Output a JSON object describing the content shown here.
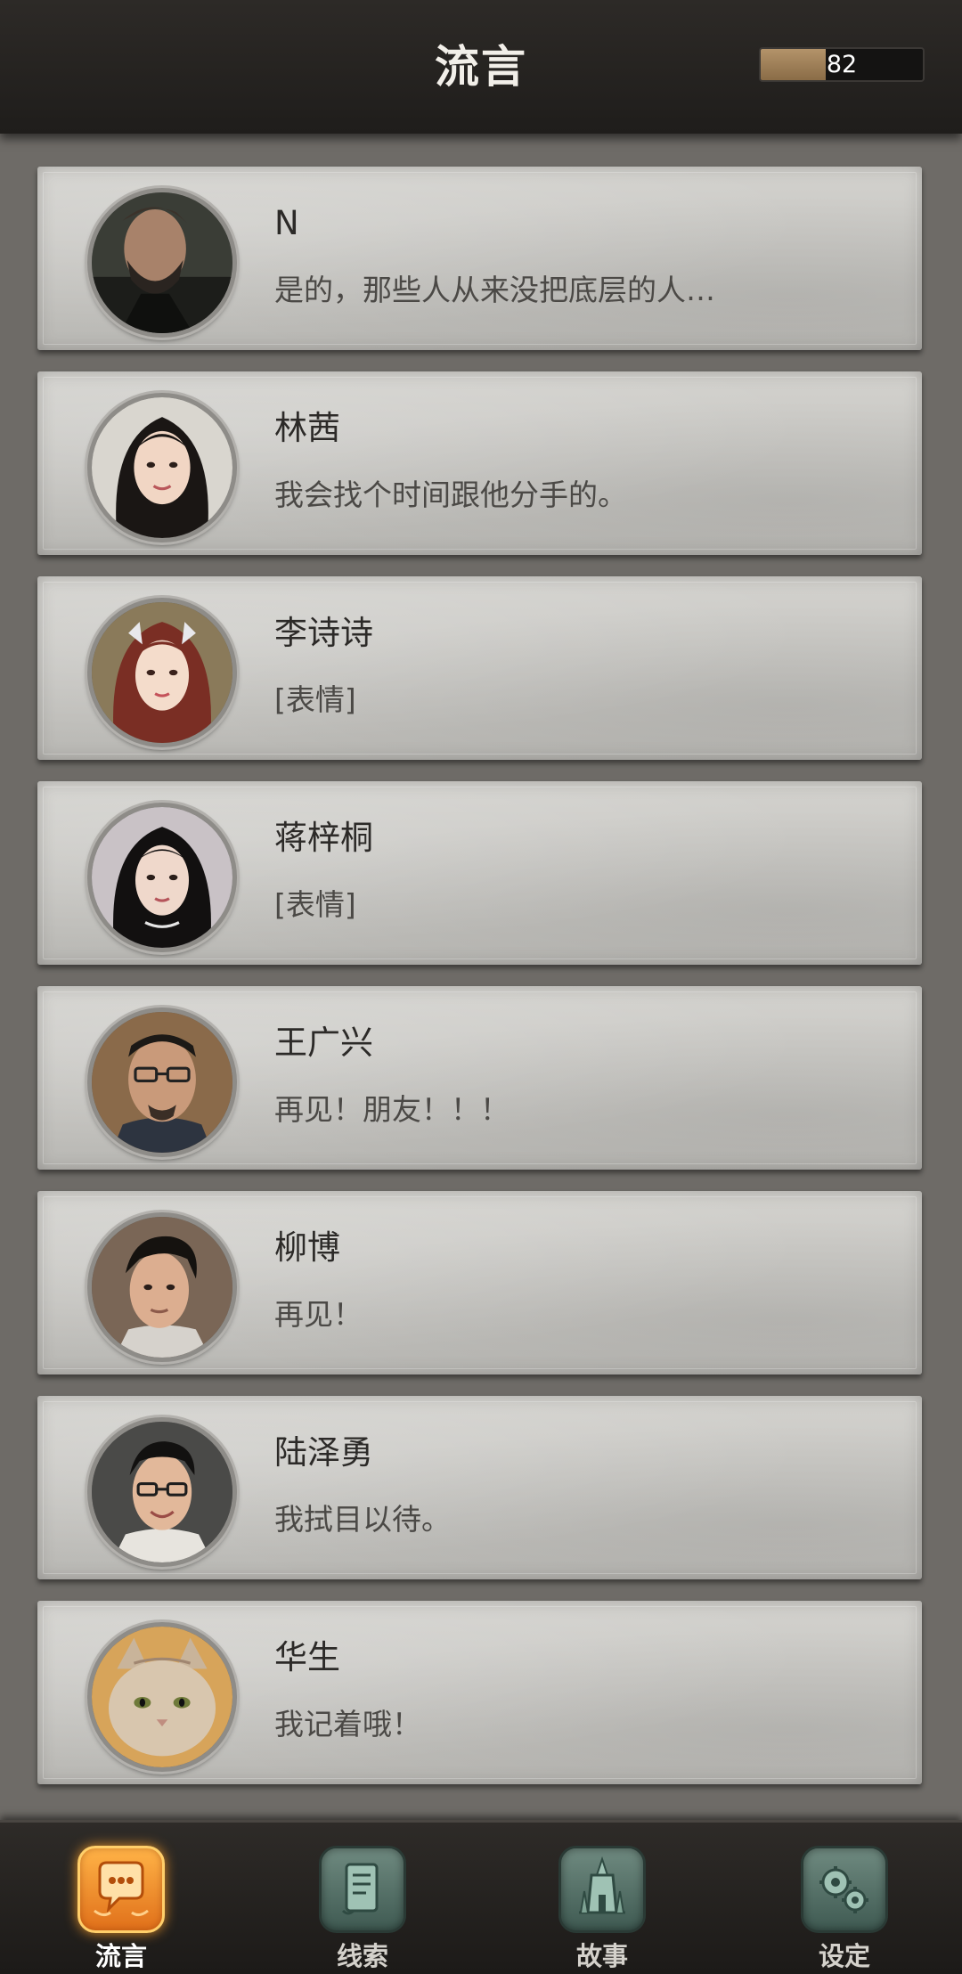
{
  "header": {
    "title": "流言",
    "meter_value": "82",
    "meter_level": 0.4
  },
  "conversations": [
    {
      "name": "N",
      "message": "是的，那些人从来没把底层的人…",
      "avatar": "man-bearded-avatar"
    },
    {
      "name": "林茜",
      "message": "我会找个时间跟他分手的。",
      "avatar": "woman-dark-hair-avatar"
    },
    {
      "name": "李诗诗",
      "message": "[表情]",
      "avatar": "woman-red-hair-avatar"
    },
    {
      "name": "蒋梓桐",
      "message": "[表情]",
      "avatar": "woman-black-hair-avatar"
    },
    {
      "name": "王广兴",
      "message": "再见！朋友！！！",
      "avatar": "man-glasses-avatar"
    },
    {
      "name": "柳博",
      "message": "再见！",
      "avatar": "man-young-avatar"
    },
    {
      "name": "陆泽勇",
      "message": "我拭目以待。",
      "avatar": "man-glasses-smiling-avatar"
    },
    {
      "name": "华生",
      "message": "我记着哦！",
      "avatar": "cat-avatar"
    }
  ],
  "nav": [
    {
      "label": "流言",
      "icon": "chat-bubble-icon",
      "active": true
    },
    {
      "label": "线索",
      "icon": "scroll-icon",
      "active": false
    },
    {
      "label": "故事",
      "icon": "building-icon",
      "active": false
    },
    {
      "label": "设定",
      "icon": "gears-icon",
      "active": false
    }
  ],
  "colors": {
    "header_bg": "#24211f",
    "card_bg": "#c8c7c3",
    "active_nav": "#f28a22",
    "inactive_nav": "#4f6b62"
  }
}
